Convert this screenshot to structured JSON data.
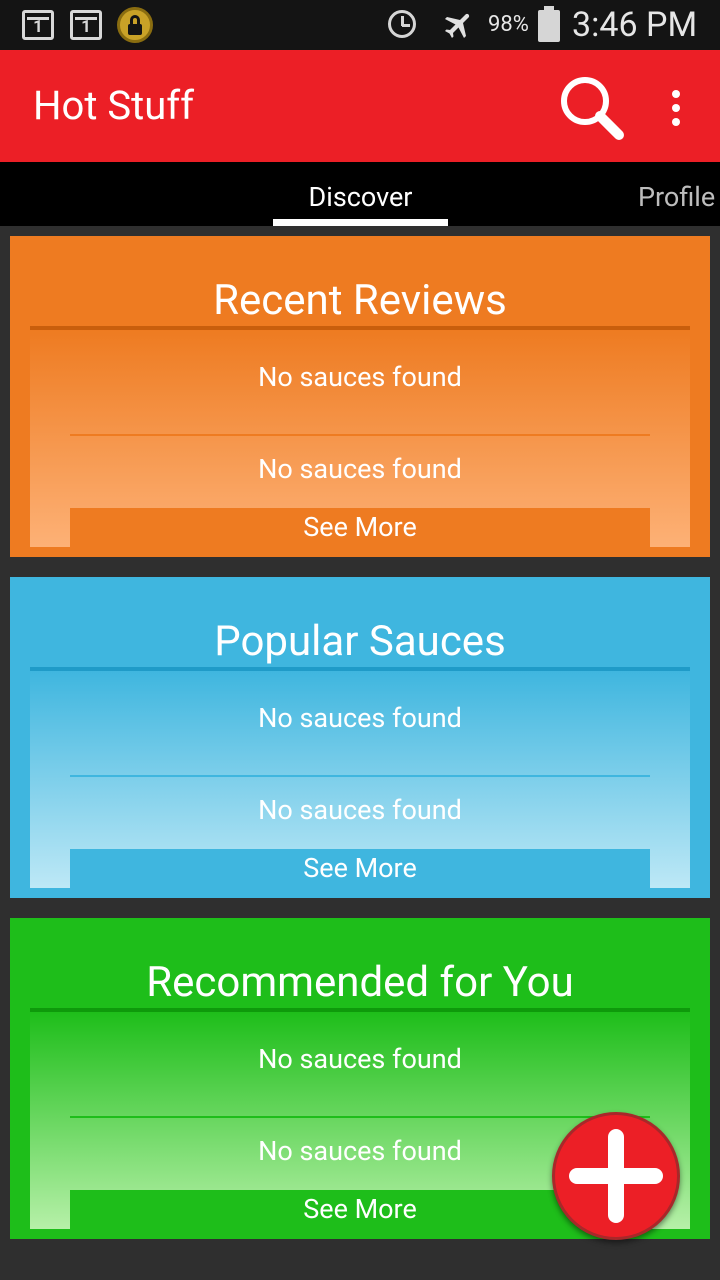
{
  "status_bar": {
    "sim1_label": "1",
    "sim2_label": "1",
    "battery_percent": "98%",
    "time": "3:46 PM",
    "icons": [
      "sim-card-icon",
      "sim-card-icon",
      "lock-icon",
      "alarm-icon",
      "airplane-mode-icon",
      "battery-icon"
    ]
  },
  "action_bar": {
    "title": "Hot Stuff",
    "color": "#ec1f26",
    "icons": [
      "search-icon",
      "overflow-menu-icon"
    ]
  },
  "tabs": [
    {
      "label": "Discover",
      "selected": true
    },
    {
      "label": "Profile",
      "selected": false
    }
  ],
  "cards": [
    {
      "title": "Recent Reviews",
      "color": "#ee7b21",
      "items": [
        "No sauces found",
        "No sauces found"
      ],
      "see_more": "See More"
    },
    {
      "title": "Popular Sauces",
      "color": "#3fb6df",
      "items": [
        "No sauces found",
        "No sauces found"
      ],
      "see_more": "See More"
    },
    {
      "title": "Recommended for You",
      "color": "#1ebe1a",
      "items": [
        "No sauces found",
        "No sauces found"
      ],
      "see_more": "See More"
    }
  ],
  "fab": {
    "icon": "plus-icon",
    "color": "#ec1f26"
  }
}
